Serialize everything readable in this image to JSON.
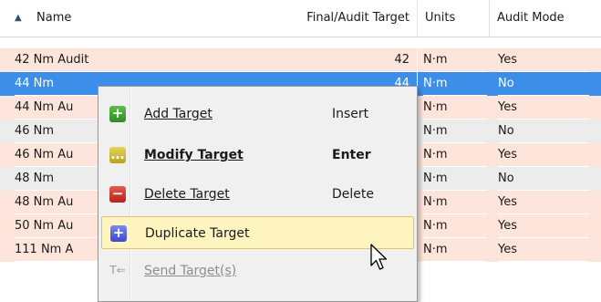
{
  "header": {
    "col_name": "Name",
    "col_target": "Final/Audit Target",
    "col_units": "Units",
    "col_audit": "Audit Mode"
  },
  "rows": [
    {
      "name": "42 Nm Audit",
      "target": "42",
      "units": "N·m",
      "audit": "Yes"
    },
    {
      "name": "44 Nm",
      "target": "44",
      "units": "N·m",
      "audit": "No"
    },
    {
      "name": "44 Nm Au",
      "target": "",
      "units": "N·m",
      "audit": "Yes"
    },
    {
      "name": "46 Nm",
      "target": "",
      "units": "N·m",
      "audit": "No"
    },
    {
      "name": "46 Nm Au",
      "target": "",
      "units": "N·m",
      "audit": "Yes"
    },
    {
      "name": "48 Nm",
      "target": "",
      "units": "N·m",
      "audit": "No"
    },
    {
      "name": "48 Nm Au",
      "target": "",
      "units": "N·m",
      "audit": "Yes"
    },
    {
      "name": "50 Nm Au",
      "target": "",
      "units": "N·m",
      "audit": "Yes"
    },
    {
      "name": "111 Nm A",
      "target": "",
      "units": "N·m",
      "audit": "Yes"
    }
  ],
  "context_menu": {
    "add": {
      "label": "Add Target",
      "shortcut": "Insert"
    },
    "modify": {
      "label": "Modify Target",
      "shortcut": "Enter"
    },
    "delete": {
      "label": "Delete Target",
      "shortcut": "Delete"
    },
    "duplicate": {
      "label": "Duplicate Target",
      "shortcut": ""
    },
    "send": {
      "label": "Send Target(s)",
      "shortcut": ""
    }
  },
  "colors": {
    "row_pink": "#fde5dc",
    "row_gray": "#ececec",
    "selected": "#3d8ee8",
    "menu_bg": "#f0f0f0",
    "hover": "#fdf4bf"
  }
}
